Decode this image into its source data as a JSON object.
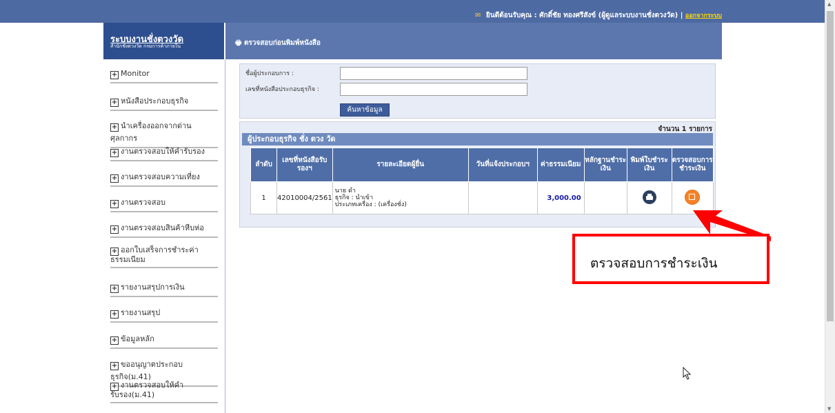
{
  "topbar": {
    "welcome": "ยินดีต้อนรับคุณ : ศักดิ์ชัย ทองศรีสังข์ (ผู้ดูแลระบบงานชั่งตวงวัด) |",
    "logout": "ออกจากระบบ"
  },
  "brand": {
    "title": "ระบบงานชั่งตวงวัด",
    "subtitle": "สำนักชั่งตวงวัด กรมการค้าภายใน"
  },
  "page": {
    "title": "ตรวจสอบก่อนพิมพ์หนังสือ"
  },
  "sidebar": {
    "items": [
      {
        "label": "Monitor"
      },
      {
        "label": "หนังสือประกอบธุรกิจ"
      },
      {
        "label": "นำเครื่องออกจากด่านศุลกากร"
      },
      {
        "label": "งานตรวจสอบให้คำรับรอง"
      },
      {
        "label": "งานตรวจสอบความเที่ยง"
      },
      {
        "label": "งานตรวจสอบ"
      },
      {
        "label": "งานตรวจสอบสินค้าหีบห่อ"
      },
      {
        "label": "ออกใบเสร็จการชำระค่าธรรมเนียม"
      },
      {
        "label": "รายงานสรุปการเงิน"
      },
      {
        "label": "รายงานสรุป"
      },
      {
        "label": "ข้อมูลหลัก"
      },
      {
        "label": "ขออนุญาตประกอบธุรกิจ(ม.41)"
      },
      {
        "label": "งานตรวจสอบให้คำรับรอง(ม.41)"
      }
    ]
  },
  "search": {
    "operator_label": "ชื่อผู้ประกอบการ :",
    "operator_value": "",
    "license_label": "เลขที่หนังสือประกอบธุรกิจ :",
    "license_value": "",
    "button": "ค้นหาข้อมูล"
  },
  "results": {
    "count_text": "จำนวน 1 รายการ",
    "section_title": "ผู้ประกอบธุรกิจ ชั่ง ตวง วัด",
    "columns": [
      "ลำดับ",
      "เลขที่หนังสือรับรองฯ",
      "รายละเอียดผู้ยื่น",
      "วันที่แจ้งประกอบฯ",
      "ค่าธรรมเนียม",
      "หลักฐานชำระเงิน",
      "พิมพ์ใบชำระเงิน",
      "ตรวจสอบการชำระเงิน"
    ],
    "rows": [
      {
        "no": "1",
        "license": "42010004/2561",
        "detail_name": "นาย ดำ",
        "detail_business": "ธุรกิจ : นำเข้า",
        "detail_type": "ประเภทเครื่อง : (เครื่องชั่ง)",
        "notify_date": "",
        "fee": "3,000.00",
        "fee_color": "#1a1aa8",
        "evidence": ""
      }
    ]
  },
  "callout": {
    "text": "ตรวจสอบการชำระเงิน",
    "color": "#ff0000"
  },
  "icons": [
    "mail-icon",
    "printer-icon",
    "plus-icon",
    "print-payment-icon",
    "check-payment-icon",
    "mouse-cursor-icon"
  ]
}
